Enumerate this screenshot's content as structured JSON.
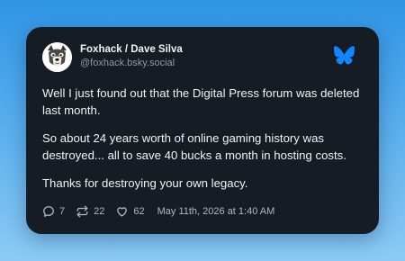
{
  "post": {
    "author": {
      "display_name": "Foxhack / Dave Silva",
      "handle": "@foxhack.bsky.social",
      "avatar_icon": "wolf-face-icon"
    },
    "platform_logo": "butterfly-icon",
    "text": [
      "Well I just found out that the Digital Press forum was deleted last month.",
      "So about 24 years worth of online gaming history was destroyed... all to save 40 bucks a month in hosting costs.",
      "Thanks for destroying your own legacy."
    ],
    "stats": {
      "replies": "7",
      "reposts": "22",
      "likes": "62"
    },
    "timestamp": "May 11th, 2026 at 1:40 AM"
  },
  "colors": {
    "background_top": "#2f95e6",
    "background_bottom": "#8ccaf4",
    "card": "#161c24",
    "text": "#f1f3f5",
    "muted": "#8b98a8",
    "brand": "#1185fe"
  }
}
